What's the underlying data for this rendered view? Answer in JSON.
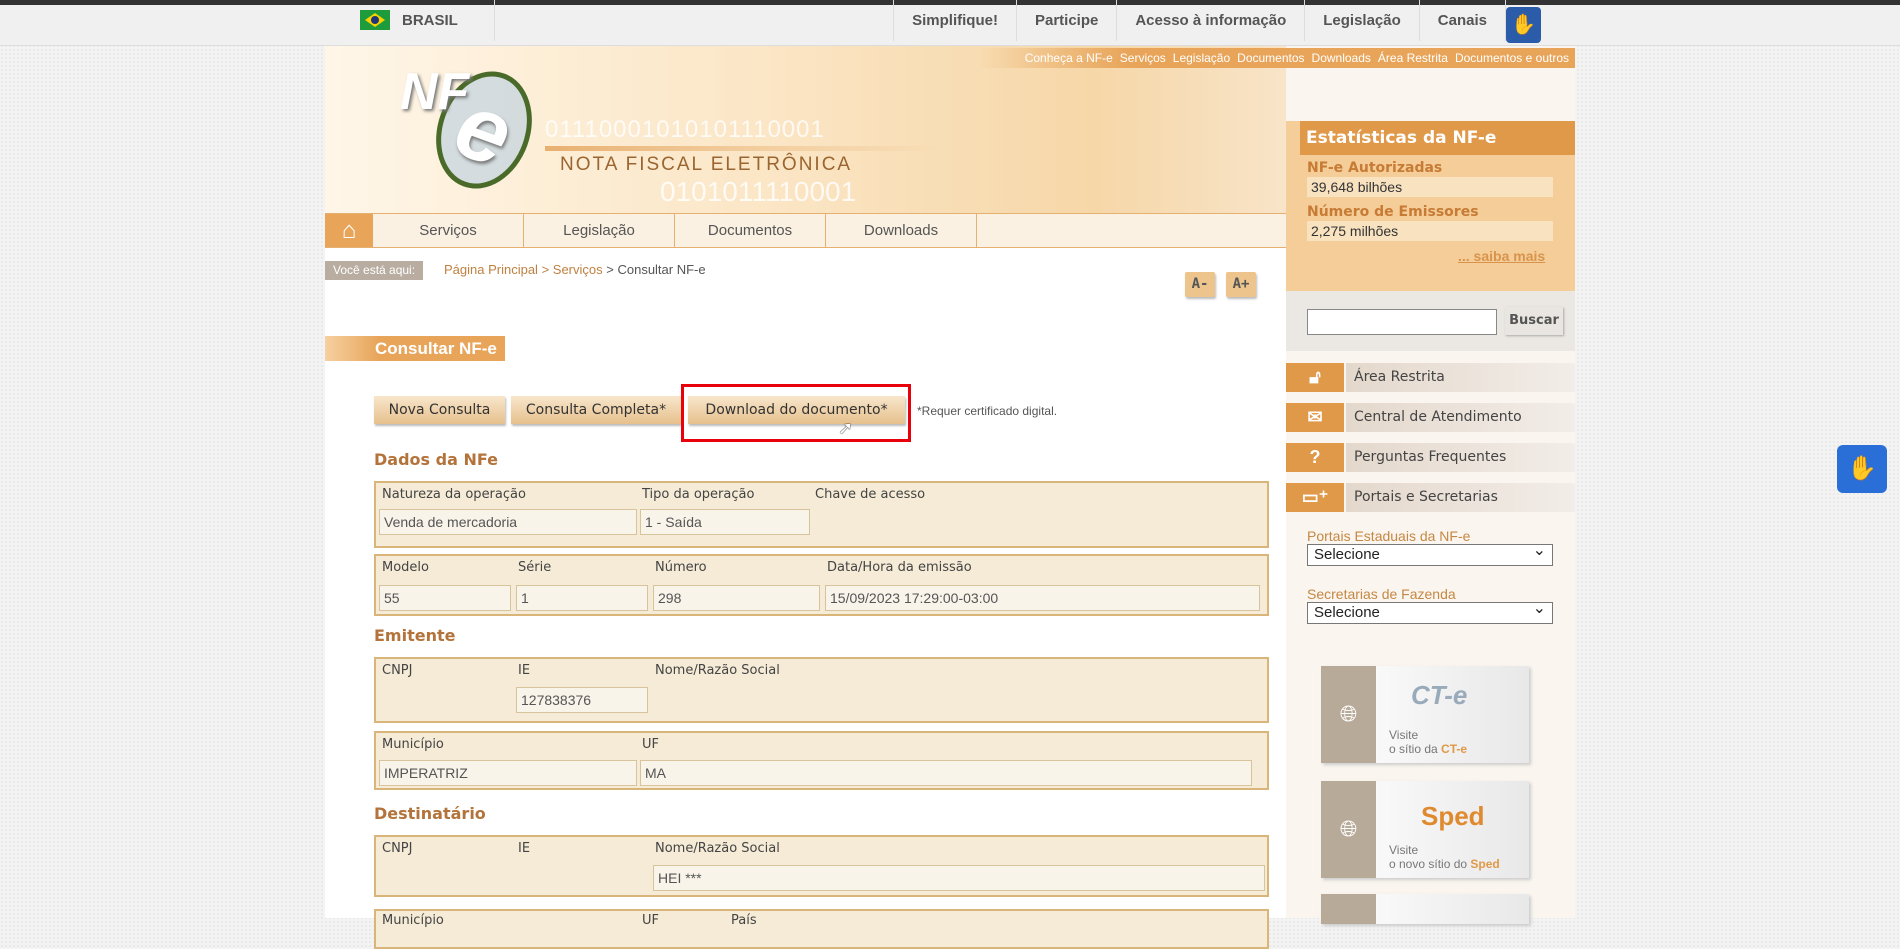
{
  "gov_bar": {
    "country": "BRASIL",
    "menu": [
      "Simplifique!",
      "Participe",
      "Acesso à informação",
      "Legislação",
      "Canais"
    ]
  },
  "top_links": [
    "Conheça a NF-e",
    "Serviços",
    "Legislação",
    "Documentos",
    "Downloads",
    "Área Restrita",
    "Documentos e outros"
  ],
  "logo": {
    "mark_nf": "NF",
    "mark_e": "e",
    "title": "NOTA FISCAL ELETRÔNICA",
    "bits1": "01110001010101110001",
    "bits2": "0101011110001"
  },
  "nav": [
    "Serviços",
    "Legislação",
    "Documentos",
    "Downloads"
  ],
  "breadcrumb": {
    "label": "Você está aqui:",
    "items": [
      "Página Principal",
      "Serviços",
      "Consultar NF-e"
    ],
    "sep": " > "
  },
  "font_buttons": [
    "A-",
    "A+"
  ],
  "page_title": "Consultar NF-e",
  "buttons": {
    "nova": "Nova Consulta",
    "completa": "Consulta Completa*",
    "download": "Download do documento*",
    "note": "*Requer certificado digital."
  },
  "dados": {
    "heading": "Dados da NFe",
    "natureza_label": "Natureza da operação",
    "natureza": "Venda de mercadoria",
    "tipo_label": "Tipo da operação",
    "tipo": "1 - Saída",
    "chave_label": "Chave de acesso",
    "modelo_label": "Modelo",
    "modelo": "55",
    "serie_label": "Série",
    "serie": "1",
    "numero_label": "Número",
    "numero": "298",
    "data_label": "Data/Hora da emissão",
    "data": "15/09/2023 17:29:00-03:00"
  },
  "emitente": {
    "heading": "Emitente",
    "cnpj_label": "CNPJ",
    "ie_label": "IE",
    "ie": "127838376",
    "nome_label": "Nome/Razão Social",
    "municipio_label": "Município",
    "municipio": "IMPERATRIZ",
    "uf_label": "UF",
    "uf": "MA"
  },
  "destinatario": {
    "heading": "Destinatário",
    "cnpj_label": "CNPJ",
    "ie_label": "IE",
    "nome_label": "Nome/Razão Social",
    "nome": "HEI ***",
    "municipio_label": "Município",
    "uf_label": "UF",
    "pais_label": "País"
  },
  "stats": {
    "title": "Estatísticas da NF-e",
    "aut_label": "NF-e Autorizadas",
    "aut": "39,648 bilhões",
    "emis_label": "Número de Emissores",
    "emis": "2,275 milhões",
    "more": "... saiba mais"
  },
  "search": {
    "button": "Buscar",
    "value": ""
  },
  "side_menu": [
    "Área Restrita",
    "Central de Atendimento",
    "Perguntas Frequentes",
    "Portais e Secretarias"
  ],
  "selects": {
    "portais_label": "Portais Estaduais da NF-e",
    "portais": "Selecione",
    "secretarias_label": "Secretarias de Fazenda",
    "secretarias": "Selecione"
  },
  "banners": {
    "cte_logo": "CT-e",
    "cte_line1": "Visite",
    "cte_line2": "o sítio da",
    "cte_name": "CT-e",
    "sped_logo": "Sped",
    "sped_line1": "Visite",
    "sped_line2": "o novo sítio do",
    "sped_name": "Sped"
  }
}
